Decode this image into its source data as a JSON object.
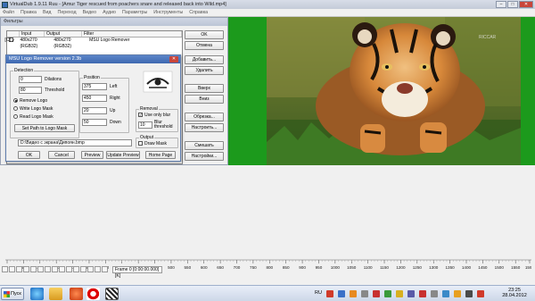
{
  "window": {
    "title": "VirtualDub 1.9.11 Ruu - [Amur Tiger rescued from poachers snare and released back into Wild.mp4]",
    "minimize": "–",
    "maximize": "□",
    "close": "✕"
  },
  "menu": [
    "Файл",
    "Правка",
    "Вид",
    "Переход",
    "Видео",
    "Аудио",
    "Параметры",
    "Инструменты",
    "Справка"
  ],
  "filters_window": {
    "title": "Фильтры",
    "columns": [
      "",
      "Input",
      "Output",
      "Filter"
    ],
    "row": {
      "checked": "✓",
      "tag": "[C]",
      "input": "480x270 (RGB32)",
      "output": "480x270 (RGB32)",
      "filter": "MSU Logo Remover"
    },
    "buttons": [
      "OK",
      "Отмена",
      "Добавить...",
      "Удалить",
      "Вверх",
      "Вниз",
      "Обрезка...",
      "Настроить...",
      "Смешать",
      "Настройки..."
    ]
  },
  "logo_dialog": {
    "title": "MSU Logo Remover version 2.3b",
    "close": "✕",
    "detection": {
      "label": "Detection",
      "dilations_value": "0",
      "dilations_label": "Dilations",
      "threshold_value": "80",
      "threshold_label": "Threshold",
      "options": [
        "Remove Logo",
        "Write Logo Mask",
        "Read Logo Mask"
      ],
      "selected": 0,
      "set_path": "Set Path to Logo Mask"
    },
    "position": {
      "label": "Position",
      "left_value": "375",
      "left_label": "Left",
      "right_value": "450",
      "right_label": "Right",
      "up_value": "20",
      "up_label": "Up",
      "down_value": "50",
      "down_label": "Down"
    },
    "removal": {
      "label": "Removal",
      "use_only_blur": "Use only blur",
      "blur_threshold_value": "10",
      "blur_threshold_label": "Blur threshold"
    },
    "output": {
      "label": "Output",
      "draw_mask": "Draw Mask"
    },
    "path": "D:\\Видео с экрана\\Дипоян.bmp",
    "buttons": [
      "OK",
      "Cancel",
      "Preview",
      "Update Preview",
      "Home Page"
    ]
  },
  "video": {
    "watermark": "RICCAR"
  },
  "timeline": {
    "ticks": [
      "0",
      "50",
      "100",
      "150",
      "200",
      "250",
      "300",
      "350",
      "400",
      "450",
      "500",
      "550",
      "600",
      "650",
      "700",
      "750",
      "800",
      "850",
      "900",
      "950",
      "1000",
      "1050",
      "1100",
      "1150",
      "1200",
      "1250",
      "1300",
      "1350",
      "1400",
      "1450",
      "1500",
      "1550",
      "1593"
    ],
    "frame_status": "Frame 0 [0:00:00.000] [K]"
  },
  "taskbar": {
    "start": "Пуск",
    "lang": "RU",
    "time": "23:25",
    "date": "28.04.2012"
  },
  "colors": {
    "green_bg": "#1c9a1c",
    "dialog_title": "#3e68b0"
  }
}
